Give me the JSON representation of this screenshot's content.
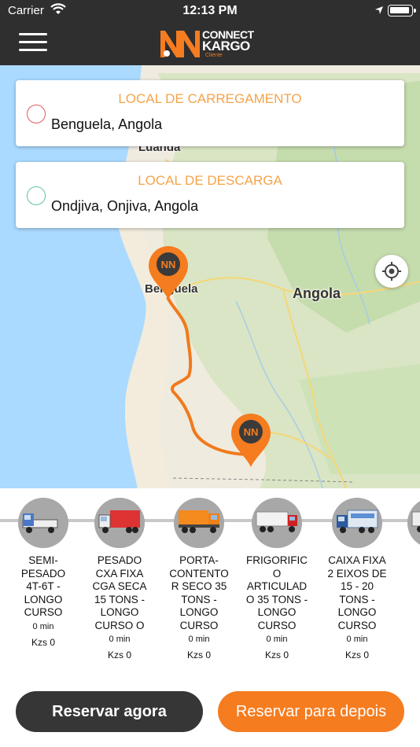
{
  "status_bar": {
    "carrier": "Carrier",
    "time": "12:13 PM"
  },
  "header": {
    "brand_line1": "CONNECT",
    "brand_line2": "KARGO",
    "brand_sub": "Cliente"
  },
  "colors": {
    "accent": "#f57c1f",
    "header_bg": "#2f2f2f",
    "route": "#f07a1d",
    "dark_button": "#363636"
  },
  "map": {
    "labels": {
      "luanda": "Luanda",
      "benguela": "Benguela",
      "angola": "Angola"
    }
  },
  "loading": {
    "title": "LOCAL DE CARREGAMENTO",
    "value": "Benguela, Angola",
    "dot_color": "#e05a5a"
  },
  "unloading": {
    "title": "LOCAL DE DESCARGA",
    "value": "Ondjiva, Onjiva, Angola",
    "dot_color": "#5fc49a"
  },
  "vehicles": [
    {
      "name": "SEMI-\nPESADO\n4T-6T -\nLONGO\nCURSO",
      "time": "0 min",
      "price": "Kzs  0",
      "icon": "light-truck-icon"
    },
    {
      "name": "PESADO\nCXA FIXA\nCGA SECA\n15 TONS -\nLONGO\nCURSO O",
      "time": "0 min",
      "price": "Kzs  0",
      "icon": "box-truck-icon"
    },
    {
      "name": "PORTA-\nCONTENTO\nR SECO 35\nTONS -\nLONGO\nCURSO",
      "time": "0 min",
      "price": "Kzs  0",
      "icon": "container-truck-icon"
    },
    {
      "name": "FRIGORIFIC\nO\nARTICULAD\nO 35 TONS -\nLONGO\nCURSO",
      "time": "0 min",
      "price": "Kzs  0",
      "icon": "reefer-truck-icon"
    },
    {
      "name": "CAIXA FIXA\n2 EIXOS DE\n15  - 20\nTONS -\nLONGO\nCURSO",
      "time": "0 min",
      "price": "Kzs  0",
      "icon": "two-axle-truck-icon"
    },
    {
      "name": "C\nAF\nO\nL",
      "time": "",
      "price": "",
      "icon": "truck-icon"
    }
  ],
  "actions": {
    "book_now": "Reservar agora",
    "book_later": "Reservar para depois"
  }
}
